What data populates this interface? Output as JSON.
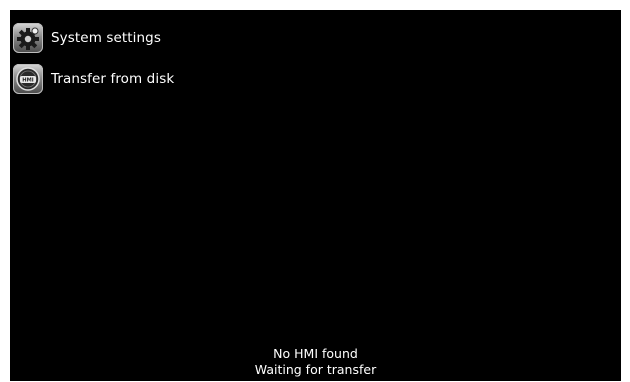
{
  "menu": {
    "items": [
      {
        "label": "System settings",
        "icon": "gear-icon"
      },
      {
        "label": "Transfer from disk",
        "icon": "hmi-disk-icon"
      }
    ]
  },
  "status": {
    "line1": "No HMI found",
    "line2": "Waiting for transfer"
  },
  "colors": {
    "background": "#000000",
    "text": "#ffffff"
  }
}
